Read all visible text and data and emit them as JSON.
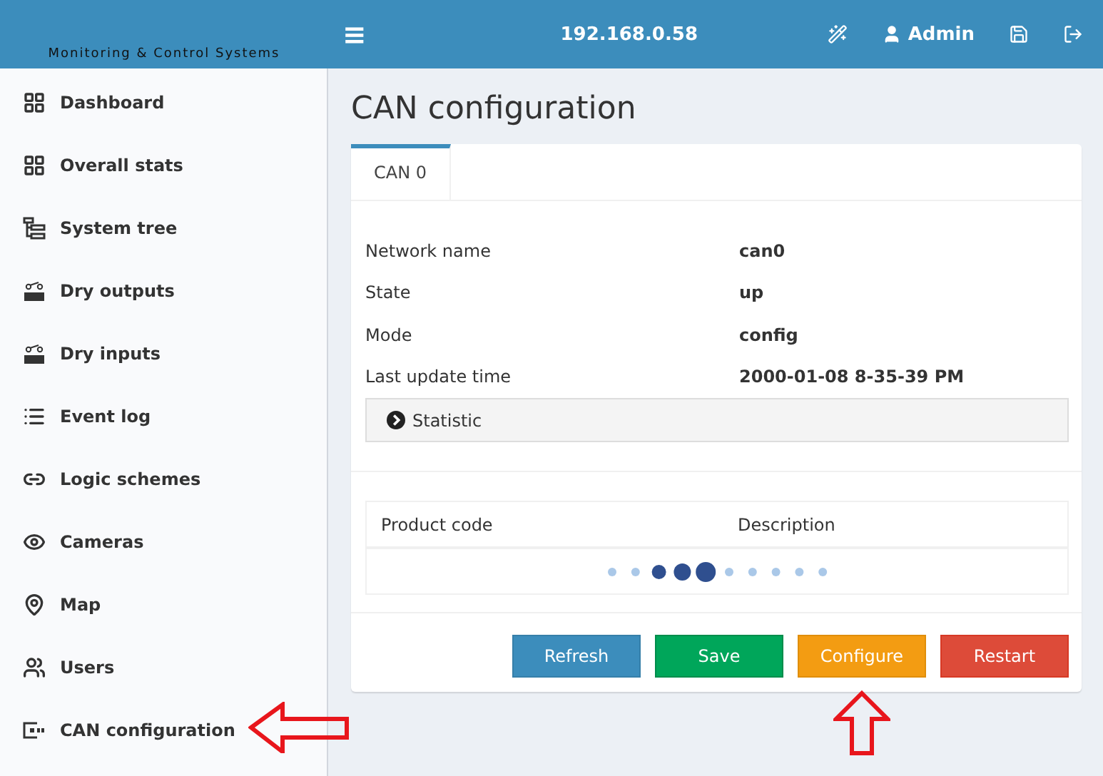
{
  "header": {
    "logo_text": "Monitoring & Control Systems",
    "menu_glyph": "≡",
    "address": "192.168.0.58",
    "user": "Admin"
  },
  "sidebar": {
    "items": [
      {
        "label": "Dashboard",
        "kind": "grid"
      },
      {
        "label": "Overall stats",
        "kind": "grid"
      },
      {
        "label": "System tree",
        "kind": "tree"
      },
      {
        "label": "Dry outputs",
        "kind": "switch"
      },
      {
        "label": "Dry inputs",
        "kind": "switch"
      },
      {
        "label": "Event log",
        "kind": "list"
      },
      {
        "label": "Logic schemes",
        "kind": "link"
      },
      {
        "label": "Cameras",
        "kind": "eye"
      },
      {
        "label": "Map",
        "kind": "pin"
      },
      {
        "label": "Users",
        "kind": "users"
      },
      {
        "label": "CAN configuration",
        "kind": "can"
      }
    ]
  },
  "page": {
    "title": "CAN configuration",
    "tabs": [
      {
        "label": "CAN 0",
        "selected": true
      }
    ],
    "fields": [
      {
        "label": "Network name",
        "value": "can0"
      },
      {
        "label": "State",
        "value": "up"
      },
      {
        "label": "Mode",
        "value": "config"
      },
      {
        "label": "Last update time",
        "value": "2000-01-08 8-35-39 PM"
      }
    ],
    "statistic": {
      "label": "Statistic",
      "expanded": false
    },
    "table": {
      "columns": [
        "Product code",
        "Description"
      ]
    },
    "buttons": [
      {
        "label": "Refresh",
        "kind": "info"
      },
      {
        "label": "Save",
        "kind": "success"
      },
      {
        "label": "Configure",
        "kind": "warning"
      },
      {
        "label": "Restart",
        "kind": "danger"
      }
    ]
  }
}
